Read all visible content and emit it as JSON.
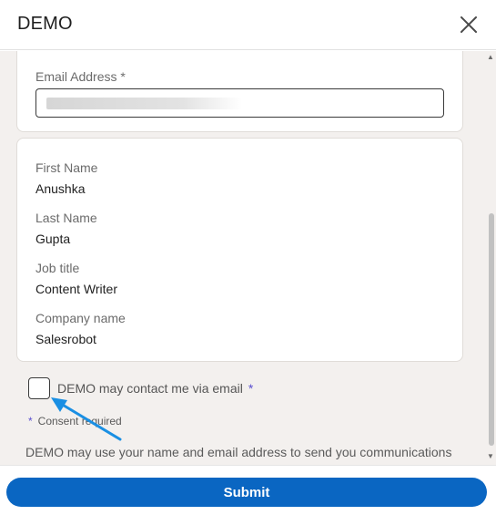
{
  "header": {
    "title": "DEMO",
    "close_icon": "close-icon"
  },
  "email_section": {
    "label": "Email Address *",
    "value": ""
  },
  "profile": {
    "fields": [
      {
        "label": "First Name",
        "value": "Anushka"
      },
      {
        "label": "Last Name",
        "value": "Gupta"
      },
      {
        "label": "Job title",
        "value": "Content Writer"
      },
      {
        "label": "Company name",
        "value": "Salesrobot"
      }
    ]
  },
  "consent": {
    "label": "DEMO may contact me via email",
    "required_marker": "*",
    "checked": false,
    "note_marker": "*",
    "note": "Consent required"
  },
  "disclaimer": "DEMO may use your name and email address to send you communications",
  "footer": {
    "submit_label": "Submit"
  },
  "colors": {
    "primary": "#0a66c2",
    "annotation_arrow": "#1a8fe3",
    "required_marker": "#5a4fcf",
    "panel_background": "#f3f0ee"
  }
}
